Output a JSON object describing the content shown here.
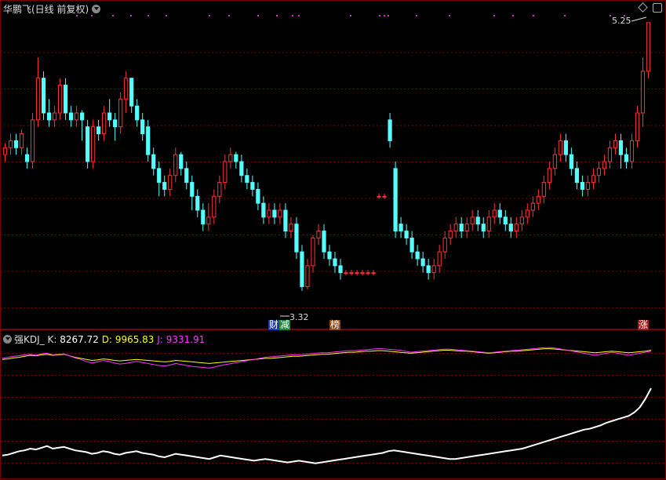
{
  "header": {
    "title": "华鹏飞(日线 前复权)"
  },
  "kdj": {
    "name": "强KDJ_",
    "k_label": "K:",
    "k_value": "8267.72",
    "d_label": "D:",
    "d_value": "9965.83",
    "j_label": "J:",
    "j_value": "9331.91"
  },
  "annotations": {
    "high": "5.25",
    "low": "3.32"
  },
  "tags": {
    "cai": "财",
    "jian": "减",
    "bang": "榜",
    "zhang": "涨"
  },
  "colors": {
    "up": "#ff3333",
    "down": "#54ffff",
    "grid": "#7a0000",
    "k_line": "#ffffff",
    "d_line": "#ffff00",
    "j_line": "#ff33ff",
    "marker_dots": "#cc33cc"
  },
  "chart_data": {
    "type": "candlestick",
    "ylim": [
      3.2,
      5.3
    ],
    "candles": [
      [
        4.3,
        4.35,
        4.25,
        4.38
      ],
      [
        4.35,
        4.4,
        4.3,
        4.45
      ],
      [
        4.4,
        4.35,
        4.3,
        4.45
      ],
      [
        4.35,
        4.45,
        4.3,
        4.48
      ],
      [
        4.3,
        4.25,
        4.2,
        4.35
      ],
      [
        4.25,
        4.55,
        4.2,
        4.6
      ],
      [
        4.55,
        4.85,
        4.5,
        5.0
      ],
      [
        4.85,
        4.6,
        4.55,
        4.9
      ],
      [
        4.6,
        4.55,
        4.5,
        4.7
      ],
      [
        4.55,
        4.6,
        4.5,
        4.65
      ],
      [
        4.6,
        4.8,
        4.55,
        4.85
      ],
      [
        4.8,
        4.6,
        4.55,
        4.85
      ],
      [
        4.6,
        4.55,
        4.5,
        4.65
      ],
      [
        4.55,
        4.6,
        4.5,
        4.65
      ],
      [
        4.6,
        4.55,
        4.4,
        4.62
      ],
      [
        4.5,
        4.25,
        4.2,
        4.55
      ],
      [
        4.25,
        4.5,
        4.2,
        4.55
      ],
      [
        4.5,
        4.45,
        4.4,
        4.55
      ],
      [
        4.45,
        4.6,
        4.4,
        4.65
      ],
      [
        4.6,
        4.55,
        4.5,
        4.7
      ],
      [
        4.55,
        4.5,
        4.4,
        4.6
      ],
      [
        4.5,
        4.7,
        4.45,
        4.75
      ],
      [
        4.7,
        4.85,
        4.6,
        4.9
      ],
      [
        4.85,
        4.65,
        4.6,
        4.85
      ],
      [
        4.65,
        4.55,
        4.5,
        4.7
      ],
      [
        4.55,
        4.45,
        4.4,
        4.6
      ],
      [
        4.5,
        4.3,
        4.25,
        4.55
      ],
      [
        4.3,
        4.2,
        4.15,
        4.35
      ],
      [
        4.2,
        4.1,
        4.0,
        4.25
      ],
      [
        4.1,
        4.05,
        4.0,
        4.15
      ],
      [
        4.05,
        4.15,
        4.0,
        4.2
      ],
      [
        4.15,
        4.3,
        4.1,
        4.35
      ],
      [
        4.3,
        4.2,
        4.15,
        4.32
      ],
      [
        4.2,
        4.1,
        4.05,
        4.25
      ],
      [
        4.1,
        4.0,
        3.9,
        4.15
      ],
      [
        4.0,
        3.9,
        3.85,
        4.05
      ],
      [
        3.9,
        3.8,
        3.75,
        3.95
      ],
      [
        3.8,
        3.85,
        3.75,
        3.95
      ],
      [
        3.85,
        4.0,
        3.8,
        4.05
      ],
      [
        4.0,
        4.1,
        3.95,
        4.15
      ],
      [
        4.1,
        4.25,
        4.05,
        4.3
      ],
      [
        4.25,
        4.3,
        4.2,
        4.35
      ],
      [
        4.3,
        4.25,
        4.2,
        4.32
      ],
      [
        4.25,
        4.15,
        4.1,
        4.3
      ],
      [
        4.15,
        4.1,
        4.05,
        4.2
      ],
      [
        4.1,
        4.05,
        4.0,
        4.15
      ],
      [
        4.05,
        3.95,
        3.9,
        4.1
      ],
      [
        3.95,
        3.85,
        3.8,
        4.0
      ],
      [
        3.85,
        3.9,
        3.8,
        3.95
      ],
      [
        3.9,
        3.85,
        3.8,
        3.95
      ],
      [
        3.85,
        3.9,
        3.8,
        3.95
      ],
      [
        3.9,
        3.75,
        3.7,
        3.95
      ],
      [
        3.75,
        3.8,
        3.7,
        3.85
      ],
      [
        3.8,
        3.6,
        3.55,
        3.85
      ],
      [
        3.6,
        3.35,
        3.32,
        3.65
      ],
      [
        3.35,
        3.5,
        3.33,
        3.55
      ],
      [
        3.5,
        3.7,
        3.45,
        3.72
      ],
      [
        3.7,
        3.75,
        3.65,
        3.8
      ],
      [
        3.75,
        3.6,
        3.55,
        3.8
      ],
      [
        3.6,
        3.55,
        3.5,
        3.65
      ],
      [
        3.55,
        3.5,
        3.45,
        3.6
      ],
      [
        3.5,
        3.45,
        3.4,
        3.55
      ],
      [
        3.45,
        3.45,
        3.43,
        3.47
      ],
      [
        3.45,
        3.45,
        3.43,
        3.47
      ],
      [
        3.45,
        3.45,
        3.43,
        3.47
      ],
      [
        3.45,
        3.45,
        3.43,
        3.47
      ],
      [
        3.45,
        3.45,
        3.43,
        3.47
      ],
      [
        3.45,
        3.45,
        3.43,
        3.47
      ],
      [
        4.0,
        4.0,
        3.98,
        4.02
      ],
      [
        4.0,
        4.0,
        3.98,
        4.02
      ],
      [
        4.55,
        4.4,
        4.35,
        4.6
      ],
      [
        4.2,
        3.75,
        3.7,
        4.25
      ],
      [
        3.8,
        3.75,
        3.7,
        3.85
      ],
      [
        3.75,
        3.7,
        3.65,
        3.8
      ],
      [
        3.7,
        3.6,
        3.55,
        3.75
      ],
      [
        3.6,
        3.55,
        3.5,
        3.65
      ],
      [
        3.55,
        3.5,
        3.45,
        3.6
      ],
      [
        3.5,
        3.45,
        3.4,
        3.55
      ],
      [
        3.45,
        3.5,
        3.4,
        3.55
      ],
      [
        3.5,
        3.6,
        3.45,
        3.65
      ],
      [
        3.6,
        3.7,
        3.55,
        3.75
      ],
      [
        3.7,
        3.75,
        3.65,
        3.8
      ],
      [
        3.75,
        3.8,
        3.7,
        3.85
      ],
      [
        3.8,
        3.75,
        3.7,
        3.85
      ],
      [
        3.75,
        3.8,
        3.7,
        3.85
      ],
      [
        3.8,
        3.85,
        3.75,
        3.9
      ],
      [
        3.85,
        3.8,
        3.75,
        3.9
      ],
      [
        3.8,
        3.75,
        3.7,
        3.85
      ],
      [
        3.75,
        3.85,
        3.7,
        3.9
      ],
      [
        3.85,
        3.9,
        3.8,
        3.95
      ],
      [
        3.9,
        3.85,
        3.8,
        3.95
      ],
      [
        3.85,
        3.8,
        3.75,
        3.9
      ],
      [
        3.8,
        3.75,
        3.7,
        3.85
      ],
      [
        3.75,
        3.8,
        3.7,
        3.85
      ],
      [
        3.8,
        3.85,
        3.75,
        3.9
      ],
      [
        3.85,
        3.9,
        3.8,
        3.95
      ],
      [
        3.9,
        3.95,
        3.85,
        4.0
      ],
      [
        3.95,
        4.0,
        3.9,
        4.05
      ],
      [
        4.0,
        4.1,
        3.95,
        4.15
      ],
      [
        4.1,
        4.2,
        4.05,
        4.25
      ],
      [
        4.2,
        4.3,
        4.15,
        4.35
      ],
      [
        4.3,
        4.4,
        4.25,
        4.45
      ],
      [
        4.4,
        4.3,
        4.25,
        4.45
      ],
      [
        4.3,
        4.2,
        4.15,
        4.35
      ],
      [
        4.2,
        4.1,
        4.05,
        4.25
      ],
      [
        4.1,
        4.05,
        4.0,
        4.15
      ],
      [
        4.05,
        4.1,
        4.0,
        4.15
      ],
      [
        4.1,
        4.15,
        4.05,
        4.2
      ],
      [
        4.15,
        4.2,
        4.1,
        4.25
      ],
      [
        4.2,
        4.25,
        4.15,
        4.3
      ],
      [
        4.25,
        4.35,
        4.2,
        4.4
      ],
      [
        4.35,
        4.4,
        4.3,
        4.45
      ],
      [
        4.4,
        4.3,
        4.2,
        4.45
      ],
      [
        4.3,
        4.25,
        4.2,
        4.35
      ],
      [
        4.25,
        4.4,
        4.2,
        4.45
      ],
      [
        4.4,
        4.6,
        4.35,
        4.65
      ],
      [
        4.6,
        4.9,
        4.5,
        5.0
      ],
      [
        4.9,
        5.25,
        4.85,
        5.25
      ]
    ],
    "k_series": [
      22,
      23,
      25,
      27,
      28,
      30,
      29,
      31,
      33,
      30,
      31,
      32,
      30,
      28,
      27,
      26,
      24,
      25,
      27,
      26,
      24,
      23,
      25,
      26,
      27,
      25,
      24,
      23,
      21,
      20,
      22,
      24,
      23,
      22,
      21,
      20,
      19,
      18,
      20,
      22,
      21,
      20,
      19,
      18,
      17,
      16,
      17,
      18,
      17,
      16,
      15,
      14,
      15,
      16,
      15,
      14,
      13,
      14,
      15,
      16,
      17,
      18,
      19,
      20,
      21,
      22,
      23,
      24,
      25,
      27,
      28,
      27,
      26,
      25,
      24,
      23,
      22,
      21,
      20,
      19,
      18,
      18,
      19,
      20,
      21,
      22,
      23,
      24,
      25,
      26,
      27,
      28,
      29,
      30,
      32,
      34,
      36,
      38,
      40,
      42,
      44,
      46,
      48,
      50,
      52,
      53,
      55,
      57,
      60,
      62,
      64,
      66,
      68,
      72,
      78,
      88,
      100
    ],
    "d_series": [
      72,
      73,
      75,
      76,
      78,
      80,
      79,
      81,
      82,
      80,
      81,
      82,
      79,
      76,
      74,
      72,
      70,
      71,
      73,
      72,
      70,
      69,
      70,
      71,
      72,
      71,
      70,
      69,
      68,
      67,
      68,
      70,
      69,
      68,
      67,
      66,
      65,
      64,
      65,
      66,
      67,
      68,
      69,
      70,
      71,
      72,
      73,
      74,
      74,
      75,
      76,
      77,
      78,
      78,
      79,
      80,
      81,
      82,
      82,
      83,
      84,
      85,
      86,
      86,
      87,
      88,
      88,
      89,
      89,
      88,
      87,
      86,
      85,
      84,
      85,
      86,
      87,
      88,
      89,
      90,
      90,
      89,
      88,
      88,
      87,
      86,
      85,
      84,
      85,
      86,
      87,
      88,
      88,
      89,
      90,
      91,
      92,
      93,
      93,
      92,
      91,
      90,
      89,
      88,
      87,
      86,
      85,
      86,
      87,
      88,
      87,
      86,
      85,
      86,
      87,
      88,
      90
    ],
    "j_series": [
      74,
      76,
      78,
      79,
      81,
      82,
      80,
      83,
      84,
      81,
      82,
      83,
      79,
      75,
      72,
      68,
      65,
      67,
      70,
      68,
      65,
      63,
      64,
      66,
      68,
      66,
      64,
      62,
      60,
      59,
      61,
      64,
      62,
      60,
      58,
      57,
      56,
      55,
      57,
      60,
      62,
      64,
      66,
      68,
      70,
      72,
      74,
      76,
      77,
      78,
      79,
      80,
      81,
      81,
      82,
      83,
      84,
      85,
      85,
      86,
      87,
      88,
      89,
      89,
      90,
      91,
      92,
      93,
      93,
      92,
      91,
      90,
      88,
      86,
      87,
      88,
      89,
      90,
      91,
      92,
      92,
      91,
      90,
      89,
      88,
      87,
      86,
      85,
      86,
      87,
      88,
      89,
      90,
      91,
      92,
      93,
      94,
      95,
      95,
      94,
      92,
      90,
      88,
      86,
      84,
      82,
      80,
      82,
      84,
      86,
      84,
      82,
      80,
      82,
      84,
      86,
      88
    ]
  }
}
